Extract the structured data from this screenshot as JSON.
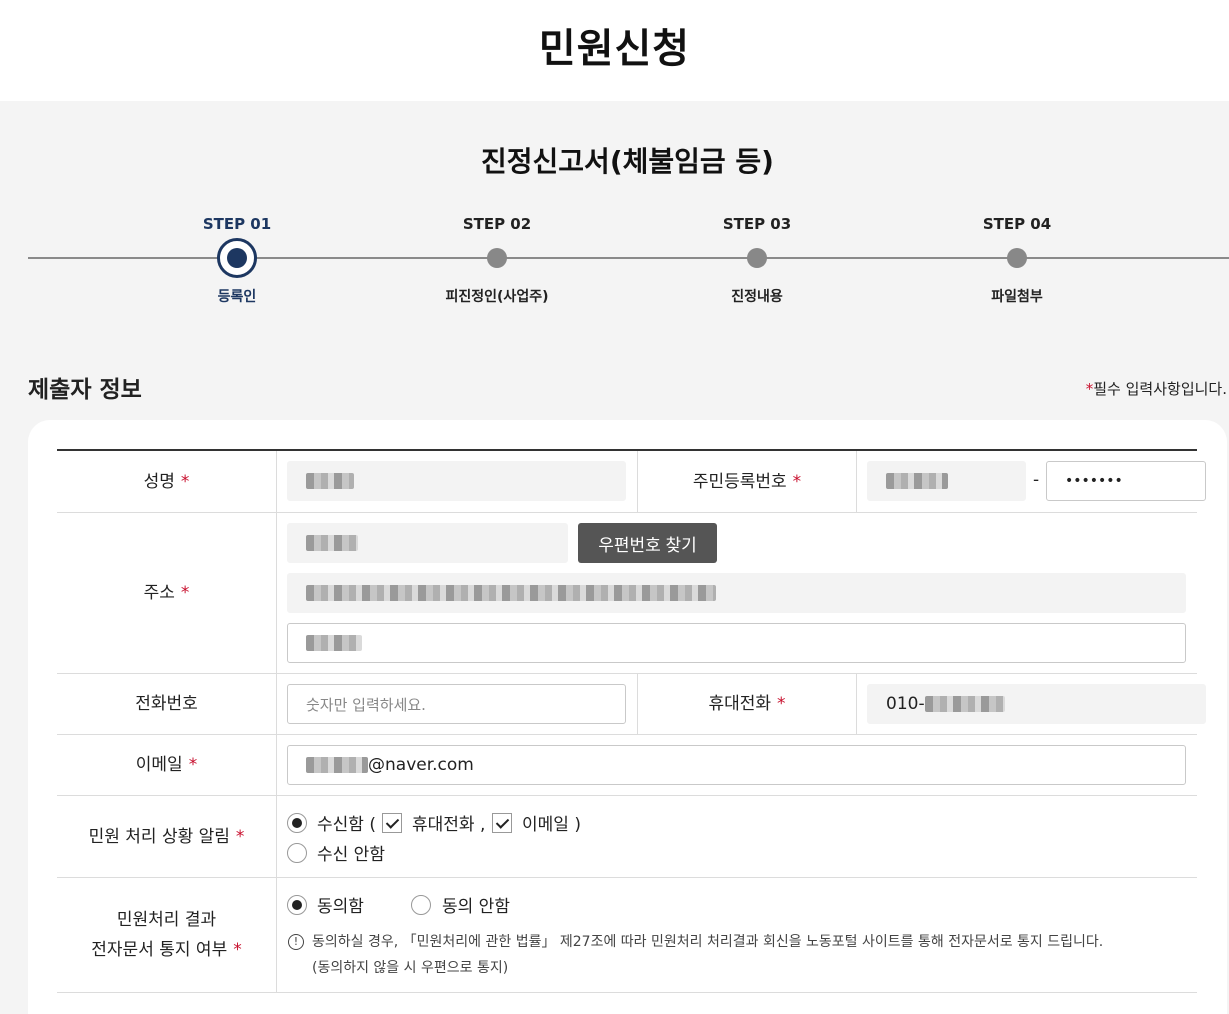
{
  "page_title": "민원신청",
  "form_title": "진정신고서(체불임금 등)",
  "steps": [
    {
      "label": "STEP 01",
      "name": "등록인"
    },
    {
      "label": "STEP 02",
      "name": "피진정인(사업주)"
    },
    {
      "label": "STEP 03",
      "name": "진정내용"
    },
    {
      "label": "STEP 04",
      "name": "파일첨부"
    }
  ],
  "section_title": "제출자 정보",
  "required_note": {
    "star": "*",
    "text": "필수 입력사항입니다."
  },
  "required_star": "*",
  "rows": {
    "name": {
      "label": "성명"
    },
    "rrn": {
      "label": "주민등록번호",
      "separator": "-",
      "back_value": "•••••••"
    },
    "address": {
      "label": "주소",
      "zip_button": "우편번호 찾기"
    },
    "phone": {
      "label": "전화번호",
      "placeholder": "숫자만 입력하세요."
    },
    "mobile": {
      "label": "휴대전화",
      "prefix": "010-"
    },
    "email": {
      "label": "이메일",
      "domain": "@naver.com"
    },
    "notify": {
      "label": "민원 처리 상황 알림",
      "receive": "수신함 (",
      "opt_mobile": "휴대전화 ,",
      "opt_email": "이메일  )",
      "no_receive": "수신 안함"
    },
    "e_doc": {
      "label_line1": "민원처리 결과",
      "label_line2": "전자문서 통지 여부",
      "agree": "동의함",
      "disagree": "동의 안함",
      "notice_icon": "!",
      "notice_line1": "동의하실 경우, 「민원처리에 관한 법률」 제27조에 따라 민원처리 처리결과 회신을 노동포털 사이트를 통해 전자문서로 통지 드립니다.",
      "notice_line2": "(동의하지 않을 시 우편으로 통지)"
    }
  }
}
